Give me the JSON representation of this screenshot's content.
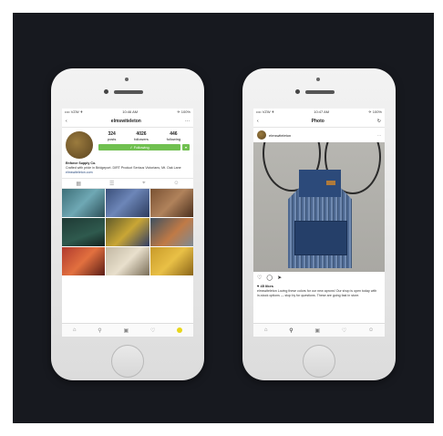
{
  "left_phone": {
    "status": {
      "carrier": "•••• VZW ✈",
      "time": "10:46 AM",
      "battery": "✈ 100%"
    },
    "nav": {
      "back": "‹",
      "title": "elmswiteleton",
      "more": "···"
    },
    "stats": [
      {
        "value": "324",
        "label": "posts"
      },
      {
        "value": "4026",
        "label": "followers"
      },
      {
        "value": "446",
        "label": "following"
      }
    ],
    "follow_label": "✓ Following",
    "follow_arrow": "▾",
    "bio": {
      "name": "Enforce Supply Co.",
      "text": "Crafted with pride in Bridgeport. DIRT Product Serious Victorians, Mt. Oak Lane",
      "link": "elmswiteleton.com"
    },
    "view_icons": [
      "grid-icon",
      "list-icon",
      "location-icon",
      "tagged-icon"
    ],
    "tabs": [
      "home-icon",
      "search-icon",
      "camera-icon",
      "heart-icon",
      "profile-icon"
    ]
  },
  "right_phone": {
    "status": {
      "carrier": "•••• VZW ✈",
      "time": "10:47 AM",
      "battery": "✈ 100%"
    },
    "nav": {
      "back": "‹",
      "title": "Photo",
      "refresh": "↻"
    },
    "post": {
      "username": "elmswiteleton",
      "more": "···",
      "likes": "♥ 45 likes",
      "caption": "elmswiteleton Loving these colors for our new aprons! Our shop is open today with in-stock options — stop by for questions. These are going fast in store."
    },
    "actions": [
      "heart-icon",
      "comment-icon",
      "send-icon"
    ],
    "tabs": [
      "home-icon",
      "search-icon",
      "camera-icon",
      "heart-icon",
      "profile-icon"
    ]
  },
  "colors": {
    "background": "#17191f",
    "follow_button": "#70c050"
  }
}
